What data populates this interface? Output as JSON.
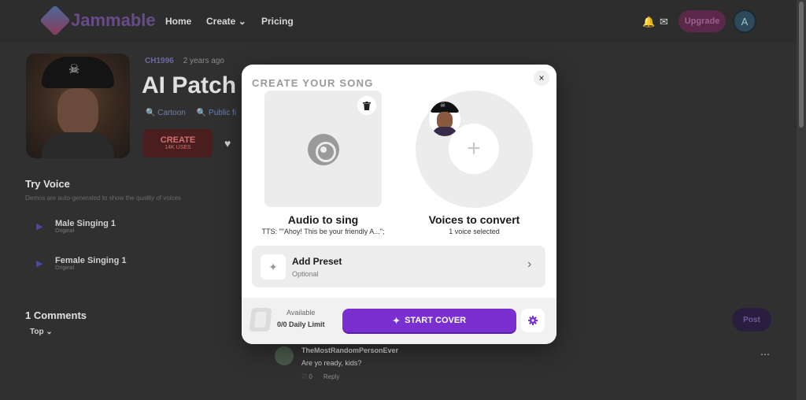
{
  "nav": {
    "brand": "Jammable",
    "links": [
      "Home",
      "Create",
      "Pricing"
    ],
    "create_chevron": "⌄",
    "upgrade": "Upgrade",
    "avatar_letter": "A"
  },
  "model": {
    "creator": "CH1996",
    "age": "2 years ago",
    "title": "AI Patch",
    "tags": [
      "Cartoon",
      "Public fi"
    ],
    "create_label": "CREATE",
    "create_sub": "14K USES"
  },
  "try_voice": {
    "heading": "Try Voice",
    "description": "Demos are auto-generated to show the quality of voices",
    "items": [
      {
        "name": "Male Singing 1",
        "sub": "Original"
      },
      {
        "name": "Female Singing 1",
        "sub": "Original"
      }
    ]
  },
  "comments": {
    "heading": "1 Comments",
    "sort": "Top",
    "post": "Post",
    "items": [
      {
        "author": "TheMostRandomPersonEver",
        "text": "Are yo ready, kids?",
        "likes": "0",
        "reply": "Reply"
      }
    ]
  },
  "modal": {
    "title": "CREATE YOUR SONG",
    "close": "×",
    "audio_label": "Audio to sing",
    "audio_sub": "TTS: \"\"Ahoy! This be your friendly A...\";",
    "voices_label": "Voices to convert",
    "voices_sub": "1 voice selected",
    "add_symbol": "+",
    "preset_title": "Add Preset",
    "preset_sub": "Optional",
    "available_label": "Available",
    "daily_limit": "0/0 Daily Limit",
    "start_label": "START COVER"
  },
  "colors": {
    "accent": "#7a2fd0",
    "modal_bg": "#ffffff",
    "overlay": "#303030"
  }
}
